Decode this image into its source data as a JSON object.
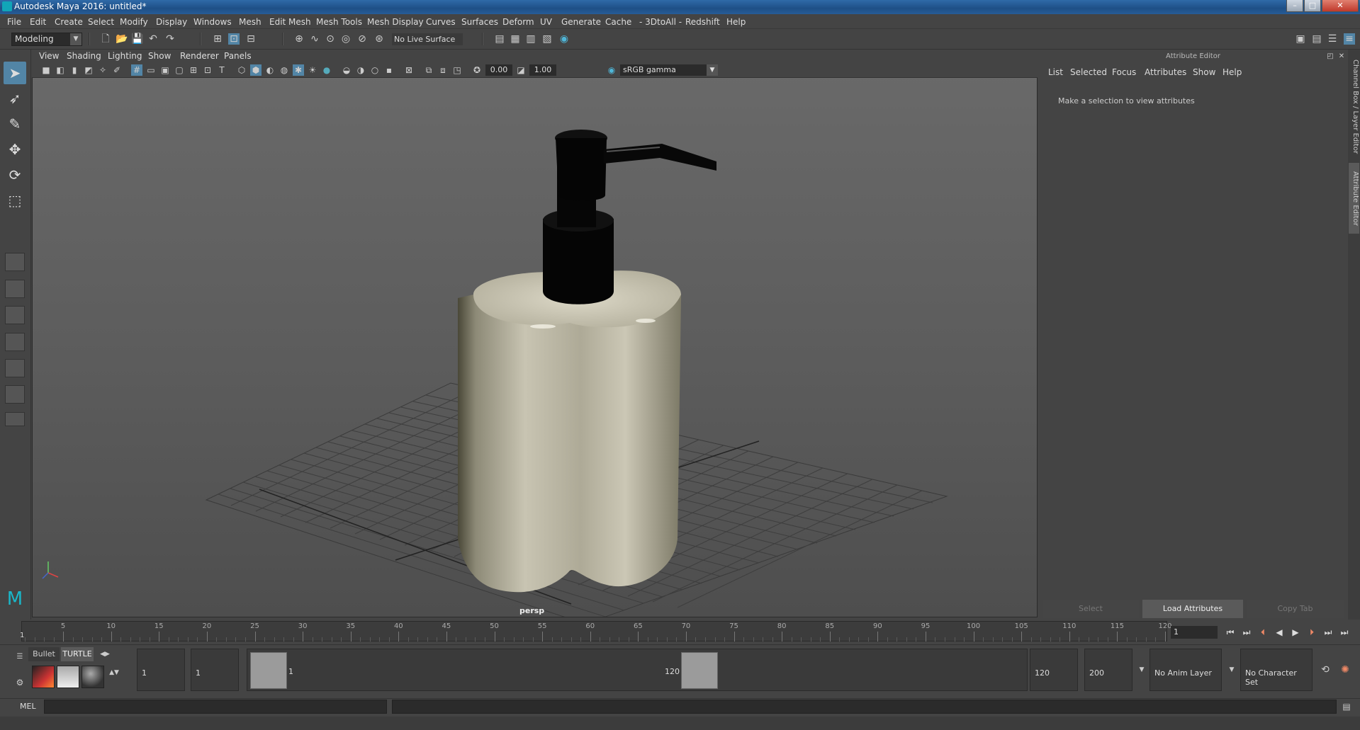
{
  "window": {
    "title": "Autodesk Maya 2016: untitled*"
  },
  "menubar": [
    "File",
    "Edit",
    "Create",
    "Select",
    "Modify",
    "Display",
    "Windows",
    "Mesh",
    "Edit Mesh",
    "Mesh Tools",
    "Mesh Display",
    "Curves",
    "Surfaces",
    "Deform",
    "UV",
    "Generate",
    "Cache",
    "- 3DtoAll -",
    "Redshift",
    "Help"
  ],
  "shelf": {
    "mode": "Modeling",
    "live_surface": "No Live Surface"
  },
  "viewport": {
    "menu": [
      "View",
      "Shading",
      "Lighting",
      "Show",
      "Renderer",
      "Panels"
    ],
    "exposure": "0.00",
    "gamma": "1.00",
    "color_space": "sRGB gamma",
    "camera_label": "persp"
  },
  "attribute_editor": {
    "header": "Attribute Editor",
    "menu": [
      "List",
      "Selected",
      "Focus",
      "Attributes",
      "Show",
      "Help"
    ],
    "message": "Make a selection to view attributes",
    "buttons": {
      "select": "Select",
      "load": "Load Attributes",
      "copy": "Copy Tab"
    }
  },
  "side_tabs": {
    "channel_box": "Channel Box / Layer Editor",
    "attribute_editor": "Attribute Editor"
  },
  "timeline": {
    "start": 1,
    "end": 120,
    "current_frame_label": "1",
    "ticks": [
      "5",
      "10",
      "15",
      "20",
      "25",
      "30",
      "35",
      "40",
      "45",
      "50",
      "55",
      "60",
      "65",
      "70",
      "75",
      "80",
      "85",
      "90",
      "95",
      "100",
      "105",
      "110",
      "115",
      "120"
    ],
    "current_frame_field": "1"
  },
  "range": {
    "start_field": "1",
    "playback_start": "1",
    "slider_start_label": "1",
    "slider_end_label": "120",
    "playback_end": "120",
    "end_field": "200",
    "anim_layer": "No Anim Layer",
    "character_set": "No Character Set"
  },
  "shelf_tabs": {
    "bullet": "Bullet",
    "turtle": "TURTLE"
  },
  "command_line": {
    "label": "MEL"
  }
}
